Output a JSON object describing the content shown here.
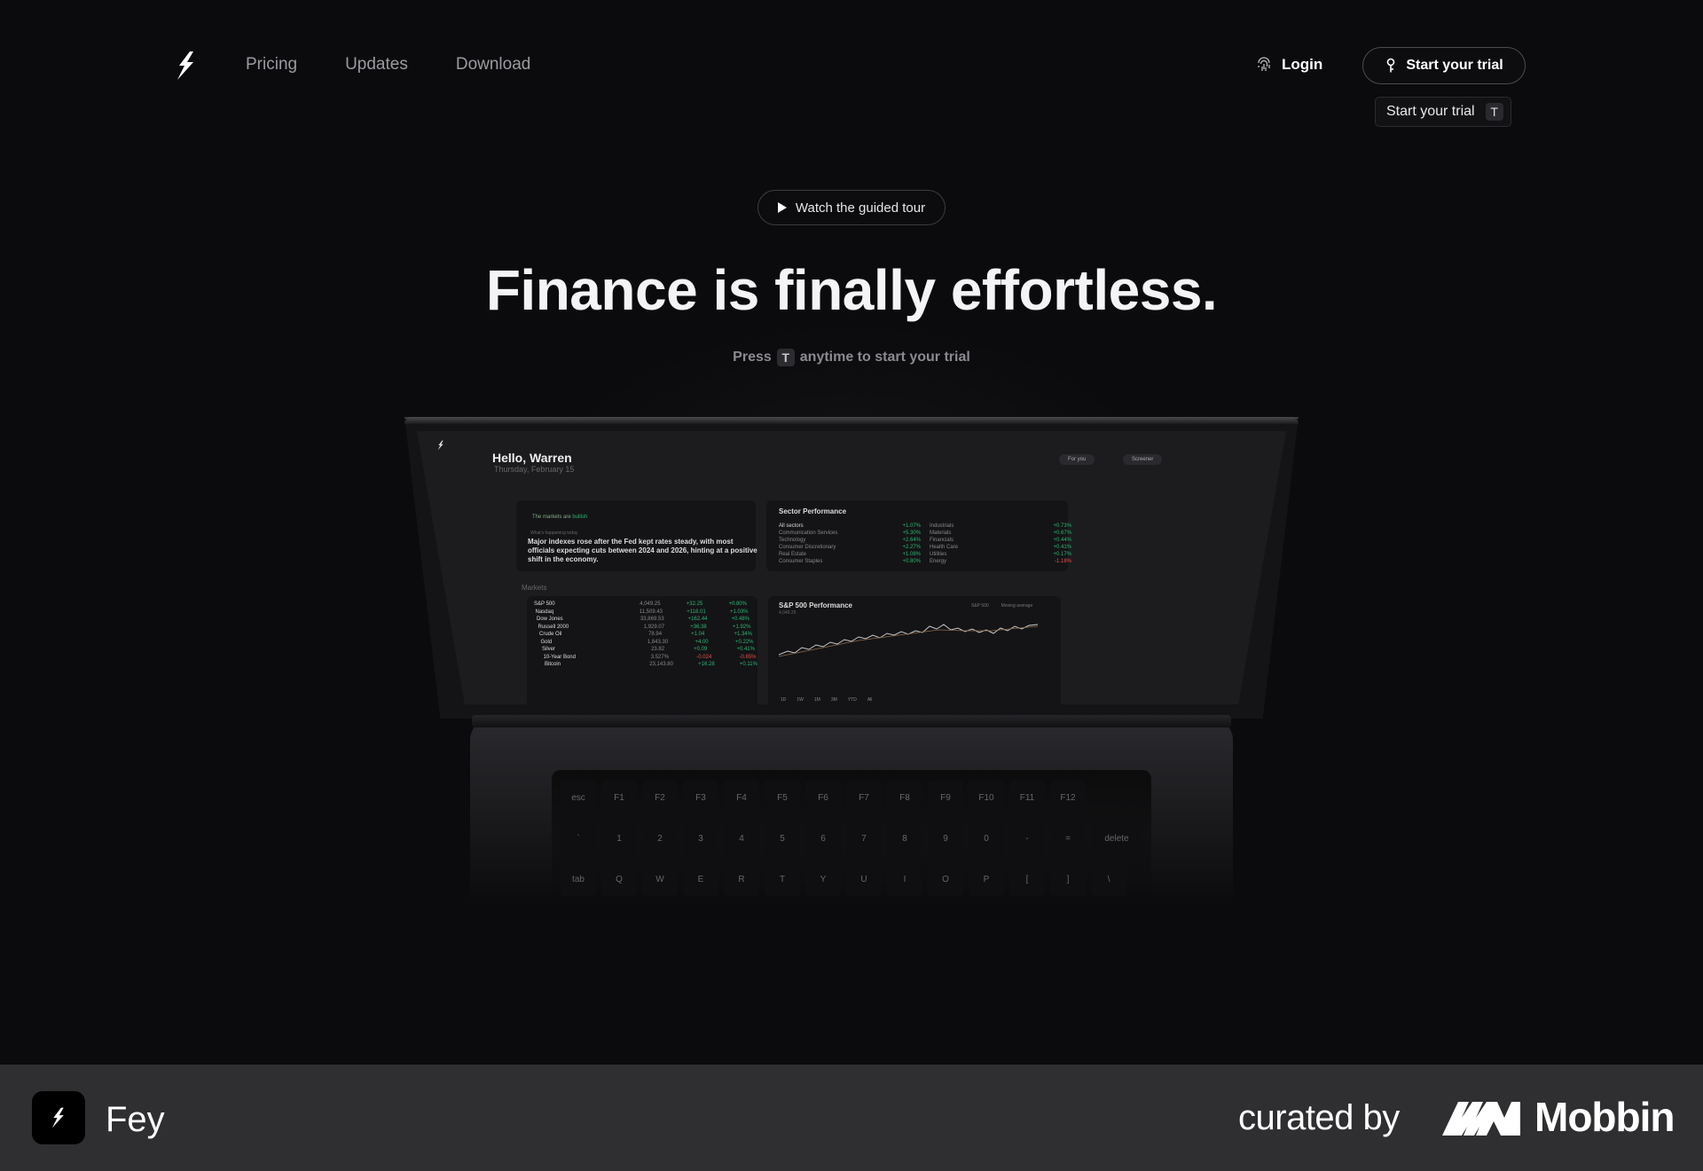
{
  "nav": {
    "links": [
      "Pricing",
      "Updates",
      "Download"
    ],
    "login_label": "Login",
    "trial_label": "Start your trial",
    "tooltip_label": "Start your trial",
    "tooltip_key": "T"
  },
  "hero": {
    "tour_label": "Watch the guided tour",
    "headline": "Finance is finally effortless.",
    "press_prefix": "Press",
    "press_key": "T",
    "press_suffix": "anytime to start your trial"
  },
  "screen": {
    "greeting": "Hello, Warren",
    "date": "Thursday, February 15",
    "pills": [
      "For you",
      "Screener"
    ],
    "mood_prefix": "The markets are",
    "mood_word": "bullish",
    "news_label": "What's happening today",
    "news": "Major indexes rose after the Fed kept rates steady, with most officials expecting cuts between 2024 and 2026, hinting at a positive shift in the economy.",
    "sector_title": "Sector Performance",
    "sectors_left": [
      {
        "name": "All sectors",
        "value": "+1.07%"
      },
      {
        "name": "Communication Services",
        "value": "+5.30%"
      },
      {
        "name": "Technology",
        "value": "+2.64%"
      },
      {
        "name": "Consumer Discretionary",
        "value": "+2.27%"
      },
      {
        "name": "Real Estate",
        "value": "+1.08%"
      },
      {
        "name": "Consumer Staples",
        "value": "+0.80%"
      }
    ],
    "sectors_right": [
      {
        "name": "Industrials",
        "value": "+0.73%"
      },
      {
        "name": "Materials",
        "value": "+0.67%"
      },
      {
        "name": "Financials",
        "value": "+0.44%"
      },
      {
        "name": "Health Care",
        "value": "+0.41%"
      },
      {
        "name": "Utilities",
        "value": "+0.17%"
      },
      {
        "name": "Energy",
        "value": "-1.18%"
      }
    ],
    "markets_label": "Markets",
    "markets": [
      {
        "name": "S&P 500",
        "price": "4,049.25",
        "change": "+32.25",
        "pct": "+0.80%"
      },
      {
        "name": "Nasdaq",
        "price": "11,509.43",
        "change": "+118.01",
        "pct": "+1.03%"
      },
      {
        "name": "Dow Jones",
        "price": "33,869.53",
        "change": "+162.44",
        "pct": "+0.48%"
      },
      {
        "name": "Russell 2000",
        "price": "1,929.07",
        "change": "+36.38",
        "pct": "+1.92%"
      },
      {
        "name": "Crude Oil",
        "price": "78.94",
        "change": "+1.04",
        "pct": "+1.34%"
      },
      {
        "name": "Gold",
        "price": "1,843.30",
        "change": "+4.00",
        "pct": "+0.22%"
      },
      {
        "name": "Silver",
        "price": "23.82",
        "change": "+0.09",
        "pct": "+0.41%"
      },
      {
        "name": "10-Year Bond",
        "price": "3.527%",
        "change": "-0.024",
        "pct": "-0.65%"
      },
      {
        "name": "Bitcoin",
        "price": "23,143.80",
        "change": "+16.28",
        "pct": "+0.11%"
      }
    ],
    "chart_title": "S&P 500 Performance",
    "chart_value": "4,049.25",
    "chart_legend": [
      "S&P 500",
      "Moving average"
    ],
    "chart_ranges": [
      "1D",
      "1W",
      "1M",
      "3M",
      "YTD",
      "All"
    ]
  },
  "keyboard": {
    "fn_row": [
      "esc",
      "F1",
      "F2",
      "F3",
      "F4",
      "F5",
      "F6",
      "F7",
      "F8",
      "F9",
      "F10",
      "F11",
      "F12"
    ],
    "num_row": [
      "`",
      "1",
      "2",
      "3",
      "4",
      "5",
      "6",
      "7",
      "8",
      "9",
      "0",
      "-",
      "=",
      "delete"
    ],
    "top_row": [
      "tab",
      "Q",
      "W",
      "E",
      "R",
      "T",
      "Y",
      "U",
      "I",
      "O",
      "P",
      "[",
      "]",
      "\\"
    ]
  },
  "footer": {
    "app_name": "Fey",
    "curated_by": "curated by",
    "brand": "Mobbin"
  },
  "colors": {
    "background": "#0b0b0d",
    "footer": "#2f2f31",
    "positive": "#2bb673",
    "negative": "#e0524f"
  }
}
